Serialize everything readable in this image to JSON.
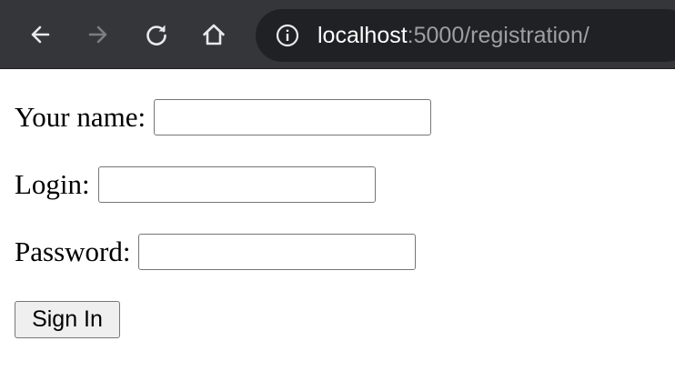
{
  "browser": {
    "url_host": "localhost",
    "url_rest": ":5000/registration/",
    "icons": [
      "back-arrow-icon",
      "forward-arrow-icon",
      "reload-icon",
      "home-icon",
      "info-icon"
    ],
    "colors": {
      "toolbar": "#35363a",
      "omnibox": "#202124",
      "url_host": "#ffffff",
      "url_rest": "#9aa0a6"
    }
  },
  "form": {
    "name_label": "Your name:",
    "name_value": "",
    "login_label": "Login:",
    "login_value": "",
    "password_label": "Password:",
    "password_value": "",
    "submit_label": "Sign In"
  }
}
